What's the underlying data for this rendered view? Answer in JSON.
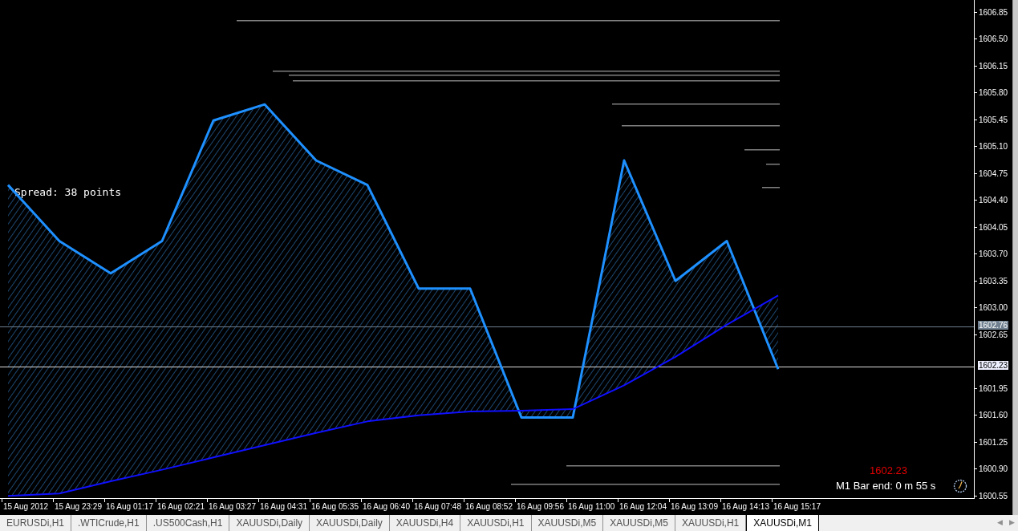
{
  "chart": {
    "spread_label": "Spread: 38 points",
    "bid_price": "1602.23",
    "bar_timer": "M1 Bar end: 0 m 55 s",
    "price_lines": [
      {
        "label": "1602.76",
        "kind": "marker"
      },
      {
        "label": "1602.23",
        "kind": "bid"
      }
    ],
    "chart_data": {
      "type": "line",
      "categories": [
        "15 Aug 2012",
        "15 Aug 23:29",
        "16 Aug 01:17",
        "16 Aug 02:21",
        "16 Aug 03:27",
        "16 Aug 04:31",
        "16 Aug 05:35",
        "16 Aug 06:40",
        "16 Aug 07:48",
        "16 Aug 08:52",
        "16 Aug 09:56",
        "16 Aug 11:00",
        "16 Aug 12:04",
        "16 Aug 13:09",
        "16 Aug 14:13",
        "16 Aug 15:17"
      ],
      "series": [
        {
          "color": "#1e90ff",
          "values": [
            1604.6,
            1603.87,
            1603.45,
            1603.87,
            1605.44,
            1605.65,
            1604.92,
            1604.6,
            1603.25,
            1603.25,
            1601.57,
            1601.57,
            1604.92,
            1603.35,
            1603.87,
            1602.2
          ]
        },
        {
          "color": "#1010ff",
          "values": [
            1600.55,
            1600.58,
            1600.74,
            1600.89,
            1601.05,
            1601.21,
            1601.37,
            1601.52,
            1601.6,
            1601.65,
            1601.66,
            1601.68,
            1601.99,
            1602.36,
            1602.78,
            1603.16
          ]
        }
      ],
      "yticks": [
        {
          "value": 1606.85,
          "label": "1606.85"
        },
        {
          "value": 1606.5,
          "label": "1606.50"
        },
        {
          "value": 1606.15,
          "label": "1606.15"
        },
        {
          "value": 1605.8,
          "label": "1605.80"
        },
        {
          "value": 1605.45,
          "label": "1605.45"
        },
        {
          "value": 1605.1,
          "label": "1605.10"
        },
        {
          "value": 1604.75,
          "label": "1604.75"
        },
        {
          "value": 1604.4,
          "label": "1604.40"
        },
        {
          "value": 1604.05,
          "label": "1604.05"
        },
        {
          "value": 1603.7,
          "label": "1603.70"
        },
        {
          "value": 1603.35,
          "label": "1603.35"
        },
        {
          "value": 1603.0,
          "label": "1603.00"
        },
        {
          "value": 1602.65,
          "label": "1602.65"
        },
        {
          "value": 1601.95,
          "label": "1601.95"
        },
        {
          "value": 1601.6,
          "label": "1601.60"
        },
        {
          "value": 1601.25,
          "label": "1601.25"
        },
        {
          "value": 1600.9,
          "label": "1600.90"
        },
        {
          "value": 1600.55,
          "label": "1600.55"
        }
      ],
      "ylim": [
        1600.51,
        1607.01
      ]
    }
  },
  "tabs": [
    {
      "label": "EURUSDi,H1",
      "selected": false
    },
    {
      "label": ".WTICrude,H1",
      "selected": false
    },
    {
      "label": ".US500Cash,H1",
      "selected": false
    },
    {
      "label": "XAUUSDi,Daily",
      "selected": false
    },
    {
      "label": "XAUUSDi,Daily",
      "selected": false
    },
    {
      "label": "XAUUSDi,H4",
      "selected": false
    },
    {
      "label": "XAUUSDi,H1",
      "selected": false
    },
    {
      "label": "XAUUSDi,M5",
      "selected": false
    },
    {
      "label": "XAUUSDi,M5",
      "selected": false
    },
    {
      "label": "XAUUSDi,H1",
      "selected": false
    },
    {
      "label": "XAUUSDi,M1",
      "selected": true
    }
  ],
  "tab_scroll": [
    "◀",
    "▶"
  ]
}
